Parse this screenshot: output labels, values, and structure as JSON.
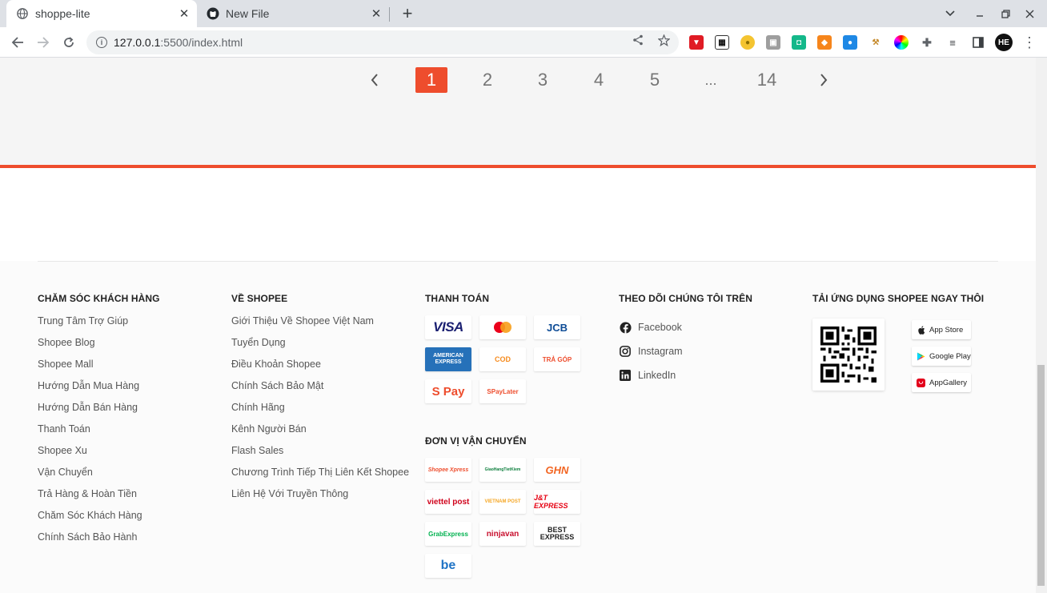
{
  "browser": {
    "tabs": [
      {
        "title": "shoppe-lite",
        "active": true,
        "icon": "globe-icon"
      },
      {
        "title": "New File",
        "active": false,
        "icon": "github-icon"
      }
    ],
    "url": {
      "host": "127.0.0.1",
      "path": ":5500/index.html"
    },
    "profile_initials": "HE"
  },
  "pagination": {
    "prev": "‹",
    "pages": [
      "1",
      "2",
      "3",
      "4",
      "5",
      "...",
      "14"
    ],
    "active_page": "1",
    "next": "›"
  },
  "footer": {
    "customer_care": {
      "title": "CHĂM SÓC KHÁCH HÀNG",
      "items": [
        "Trung Tâm Trợ Giúp",
        "Shopee Blog",
        "Shopee Mall",
        "Hướng Dẫn Mua Hàng",
        "Hướng Dẫn Bán Hàng",
        "Thanh Toán",
        "Shopee Xu",
        "Vận Chuyển",
        "Trả Hàng & Hoàn Tiền",
        "Chăm Sóc Khách Hàng",
        "Chính Sách Bảo Hành"
      ]
    },
    "about": {
      "title": "VỀ SHOPEE",
      "items": [
        "Giới Thiệu Về Shopee Việt Nam",
        "Tuyển Dụng",
        "Điều Khoản Shopee",
        "Chính Sách Bảo Mật",
        "Chính Hãng",
        "Kênh Người Bán",
        "Flash Sales",
        "Chương Trình Tiếp Thị Liên Kết Shopee",
        "Liên Hệ Với Truyền Thông"
      ]
    },
    "payment": {
      "title": "THANH TOÁN",
      "logos": [
        "VISA",
        "mastercard",
        "JCB",
        "AMERICAN EXPRESS",
        "COD",
        "TRẢ GÓP",
        "S Pay",
        "SPayLater"
      ]
    },
    "shipping": {
      "title": "ĐƠN VỊ VẬN CHUYỂN",
      "logos": [
        "Shopee Xpress",
        "GiaoHangTietKiem",
        "GHN",
        "viettel post",
        "VIETNAM POST",
        "J&T EXPRESS",
        "GrabExpress",
        "ninjavan",
        "BEST EXPRESS",
        "be"
      ]
    },
    "follow": {
      "title": "THEO DÕI CHÚNG TÔI TRÊN",
      "items": [
        {
          "label": "Facebook",
          "icon": "facebook-icon"
        },
        {
          "label": "Instagram",
          "icon": "instagram-icon"
        },
        {
          "label": "LinkedIn",
          "icon": "linkedin-icon"
        }
      ]
    },
    "app": {
      "title": "TẢI ỨNG DỤNG SHOPEE NGAY THÔI",
      "stores": [
        "App Store",
        "Google Play",
        "AppGallery"
      ]
    }
  },
  "colors": {
    "brand": "#ee4d2d"
  }
}
